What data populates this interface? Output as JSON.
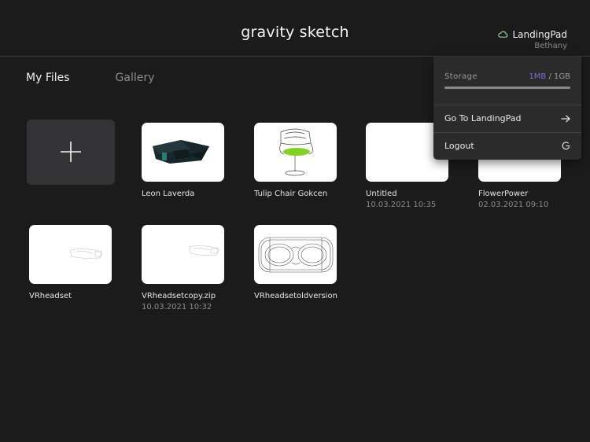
{
  "header": {
    "logo": "gravity sketch",
    "account_name": "LandingPad",
    "account_user": "Bethany",
    "account_icon": "cloud-icon"
  },
  "tabs": [
    {
      "label": "My Files",
      "active": true
    },
    {
      "label": "Gallery",
      "active": false
    }
  ],
  "new_file_icon": "plus-icon",
  "files": [
    {
      "name": "Leon Laverda",
      "date": ""
    },
    {
      "name": "Tulip Chair Gokcen",
      "date": ""
    },
    {
      "name": "Untitled",
      "date": "10.03.2021 10:35"
    },
    {
      "name": "FlowerPower",
      "date": "02.03.2021 09:10"
    },
    {
      "name": "VRheadset",
      "date": ""
    },
    {
      "name": "VRheadsetcopy.zip",
      "date": "10.03.2021 10:32"
    },
    {
      "name": "VRheadsetoldversion",
      "date": ""
    }
  ],
  "dropdown": {
    "storage_label": "Storage",
    "storage_used": "1MB",
    "storage_sep": " / ",
    "storage_total": "1GB",
    "storage_fraction": 0.001,
    "items": [
      {
        "label": "Go To LandingPad",
        "icon": "arrow-right-icon"
      },
      {
        "label": "Logout",
        "icon": "logout-icon"
      }
    ]
  },
  "colors": {
    "background": "#1b1b1c",
    "accent": "#7b6bd8",
    "cloud": "#8fd0a0",
    "chair_seat": "#7ed321"
  }
}
